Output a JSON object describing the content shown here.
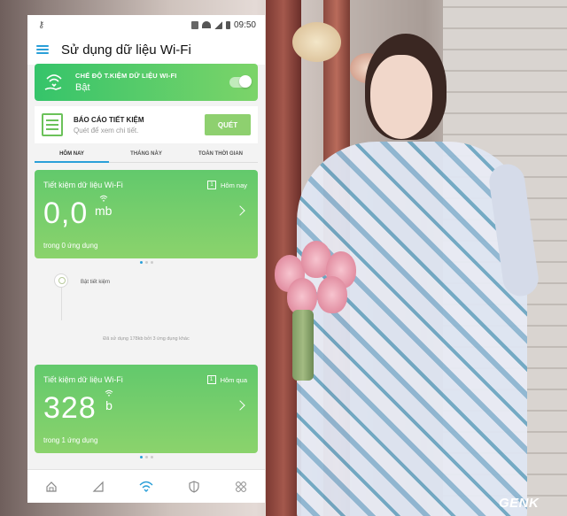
{
  "status_bar": {
    "left_icon": "key-icon",
    "time": "09:50",
    "icons": [
      "wifi-icon",
      "signal-icon",
      "battery-icon"
    ]
  },
  "app_bar": {
    "title": "Sử dụng dữ liệu Wi-Fi"
  },
  "mode_card": {
    "label": "CHẾ ĐỘ T.KIỆM DỮ LIỆU WI-FI",
    "value": "Bật",
    "toggle_on": true
  },
  "report_card": {
    "title": "BÁO CÁO TIẾT KIỆM",
    "subtitle": "Quét để xem chi tiết.",
    "button": "QUÉT"
  },
  "tabs": [
    {
      "label": "HÔM NAY",
      "active": true
    },
    {
      "label": "THÁNG NÀY",
      "active": false
    },
    {
      "label": "TOÀN THỜI GIAN",
      "active": false
    }
  ],
  "card_today": {
    "title": "Tiết kiệm dữ liệu Wi-Fi",
    "range_num": "1",
    "range": "Hôm nay",
    "value": "0,0",
    "unit": "mb",
    "apps": "trong 0 ứng dụng"
  },
  "timeline": {
    "label": "Bật tiết kiệm",
    "note": "Đã sử dụng 178kb bởi 3 ứng dụng khác"
  },
  "card_yesterday": {
    "title": "Tiết kiệm dữ liệu Wi-Fi",
    "range_num": "1",
    "range": "Hôm qua",
    "value": "328",
    "unit": "b",
    "apps": "trong 1 ứng dụng"
  },
  "bottom_nav": [
    "home-icon",
    "signal-icon",
    "wifi-icon",
    "shield-icon",
    "apps-icon"
  ],
  "watermark": "GENK",
  "colors": {
    "accent": "#2a9fd8",
    "green_start": "#35c46a",
    "green_end": "#8bd36c"
  }
}
